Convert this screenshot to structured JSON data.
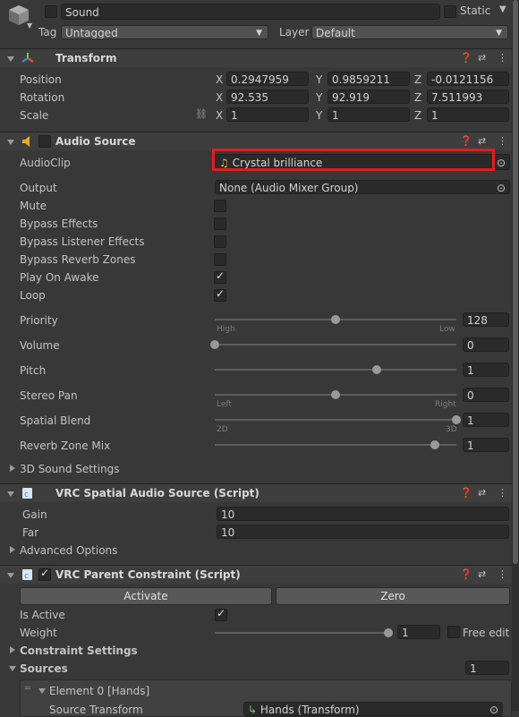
{
  "header": {
    "name": "Sound",
    "static_label": "Static",
    "tag_label": "Tag",
    "tag_value": "Untagged",
    "layer_label": "Layer",
    "layer_value": "Default"
  },
  "transform": {
    "title": "Transform",
    "position": {
      "label": "Position",
      "x": "0.2947959",
      "y": "0.9859211",
      "z": "-0.0121156"
    },
    "rotation": {
      "label": "Rotation",
      "x": "92.535",
      "y": "92.919",
      "z": "7.511993"
    },
    "scale": {
      "label": "Scale",
      "x": "1",
      "y": "1",
      "z": "1"
    },
    "axes": {
      "x": "X",
      "y": "Y",
      "z": "Z"
    }
  },
  "audio_source": {
    "title": "Audio Source",
    "audioclip_label": "AudioClip",
    "audioclip_value": "Crystal brilliance",
    "output_label": "Output",
    "output_value": "None (Audio Mixer Group)",
    "mute_label": "Mute",
    "bypass_effects_label": "Bypass Effects",
    "bypass_listener_label": "Bypass Listener Effects",
    "bypass_reverb_label": "Bypass Reverb Zones",
    "play_on_awake_label": "Play On Awake",
    "loop_label": "Loop",
    "mute": false,
    "bypass_effects": false,
    "bypass_listener": false,
    "bypass_reverb": false,
    "play_on_awake": true,
    "loop": true,
    "priority": {
      "label": "Priority",
      "value": "128",
      "min_label": "High",
      "max_label": "Low",
      "fraction": 0.5
    },
    "volume": {
      "label": "Volume",
      "value": "0",
      "fraction": 0.0
    },
    "pitch": {
      "label": "Pitch",
      "value": "1",
      "fraction": 0.67
    },
    "stereo_pan": {
      "label": "Stereo Pan",
      "value": "0",
      "min_label": "Left",
      "max_label": "Right",
      "fraction": 0.5
    },
    "spatial_blend": {
      "label": "Spatial Blend",
      "value": "1",
      "min_label": "2D",
      "max_label": "3D",
      "fraction": 1.0
    },
    "reverb_zone_mix": {
      "label": "Reverb Zone Mix",
      "value": "1",
      "fraction": 0.91
    },
    "sound_settings_label": "3D Sound Settings"
  },
  "vrc_spatial": {
    "title": "VRC Spatial Audio Source (Script)",
    "gain_label": "Gain",
    "gain_value": "10",
    "far_label": "Far",
    "far_value": "10",
    "advanced_label": "Advanced Options"
  },
  "vrc_parent": {
    "title": "VRC Parent Constraint (Script)",
    "activate_label": "Activate",
    "zero_label": "Zero",
    "is_active_label": "Is Active",
    "is_active": true,
    "weight_label": "Weight",
    "weight_value": "1",
    "weight_fraction": 1.0,
    "free_edit_label": "Free edit",
    "constraint_settings_label": "Constraint Settings",
    "sources_label": "Sources",
    "sources_count": "1",
    "element_label": "Element 0 [Hands]",
    "source_transform_label": "Source Transform",
    "source_transform_value": "Hands (Transform)"
  },
  "colors": {
    "highlight": "#e01e1e",
    "accent": "#4d8ad7"
  }
}
